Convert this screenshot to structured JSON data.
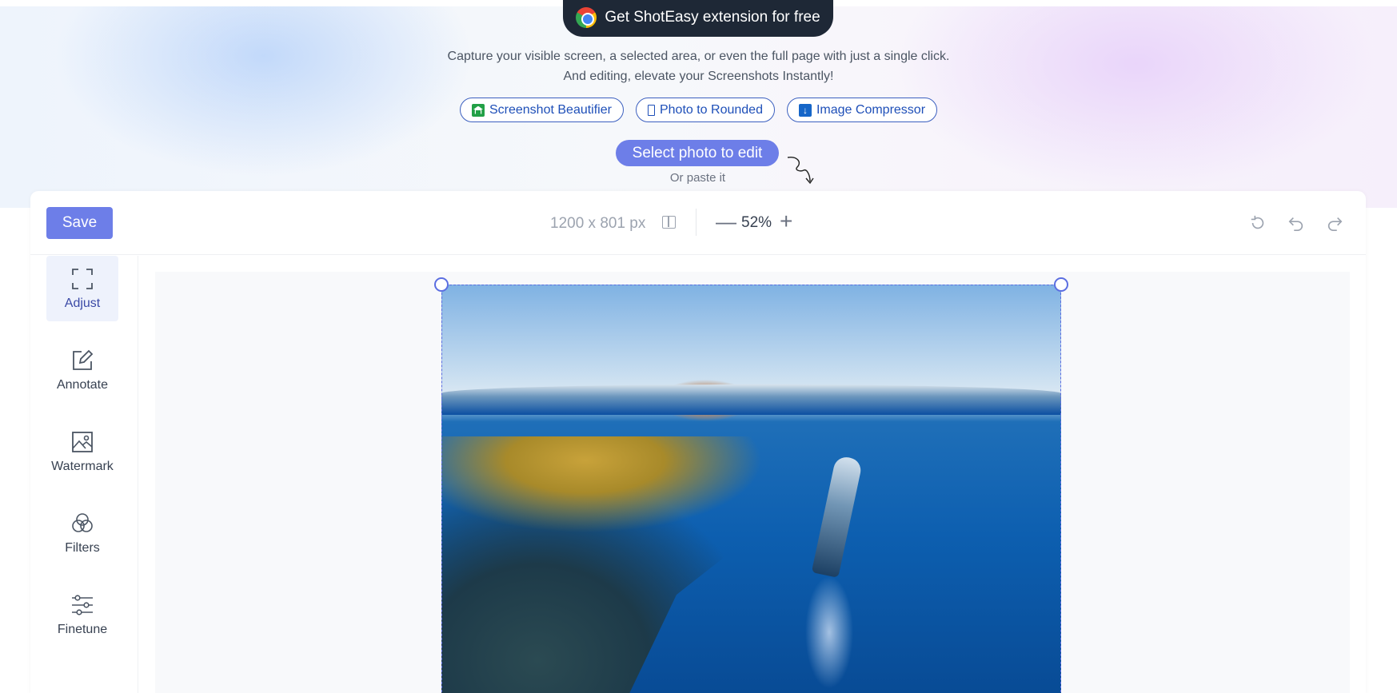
{
  "hero": {
    "extension_button": "Get ShotEasy extension for free",
    "tagline_line1": "Capture your visible screen, a selected area, or even the full page with just a single click.",
    "tagline_line2": "And editing, elevate your Screenshots Instantly!",
    "tool_links": [
      {
        "label": "Screenshot Beautifier",
        "icon": "green-house-icon"
      },
      {
        "label": "Photo to Rounded",
        "icon": "rounded-box-icon"
      },
      {
        "label": "Image Compressor",
        "icon": "download-arrow-icon"
      }
    ],
    "select_button": "Select photo to edit",
    "paste_hint": "Or paste it"
  },
  "toolbar": {
    "save_label": "Save",
    "dimensions": "1200 x 801 px",
    "zoom_out": "—",
    "zoom_level": "52%",
    "zoom_in": "+",
    "history_icons": [
      "reset-icon",
      "undo-icon",
      "redo-icon"
    ]
  },
  "sidebar": {
    "items": [
      {
        "label": "Adjust",
        "icon": "crop-corners-icon",
        "active": true
      },
      {
        "label": "Annotate",
        "icon": "pencil-square-icon",
        "active": false
      },
      {
        "label": "Watermark",
        "icon": "image-watermark-icon",
        "active": false
      },
      {
        "label": "Filters",
        "icon": "circles-overlap-icon",
        "active": false
      },
      {
        "label": "Finetune",
        "icon": "sliders-icon",
        "active": false
      }
    ]
  },
  "canvas": {
    "photo_subject": "underwater-diver-reef-photo"
  },
  "colors": {
    "accent": "#6d7ee8",
    "dark_button": "#1e2836",
    "link_blue": "#1e4fb8"
  }
}
